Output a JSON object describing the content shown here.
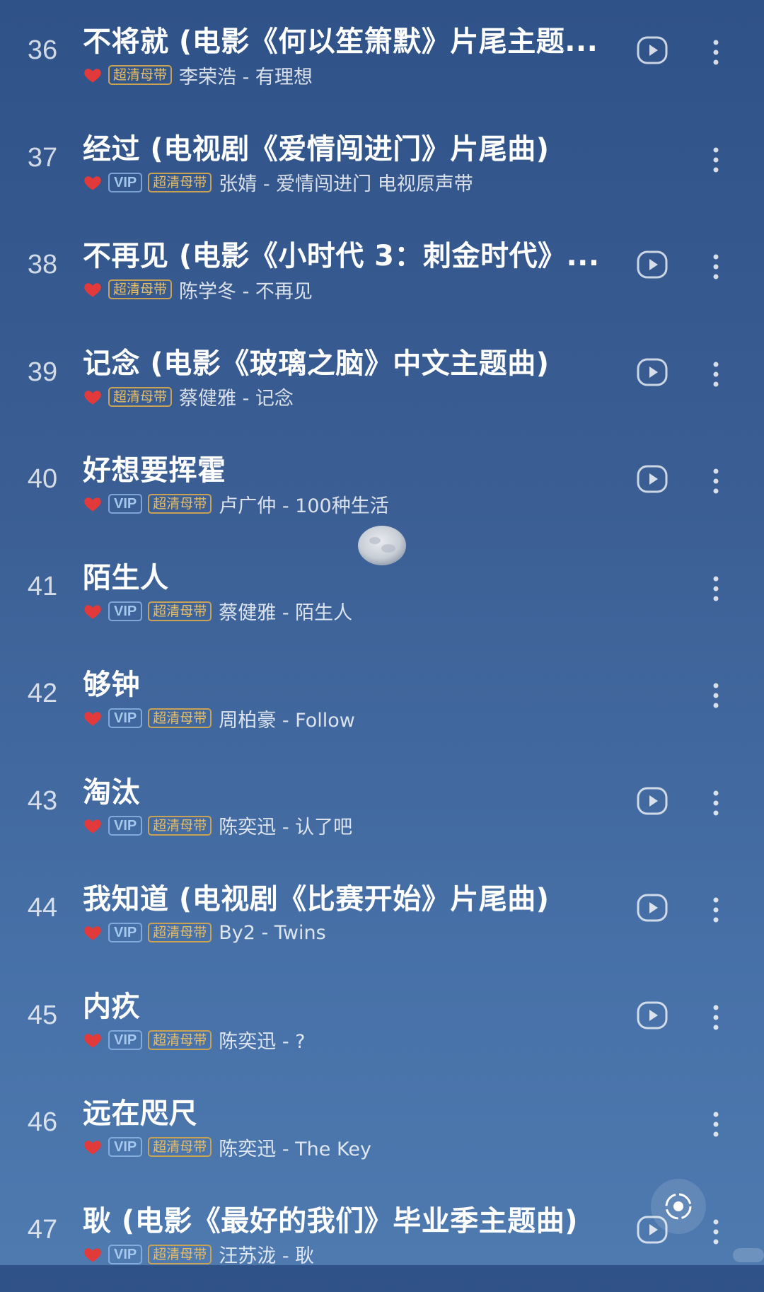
{
  "vip_label": "VIP",
  "hq_label": "超清母带",
  "colors": {
    "heart": "#e23a3a",
    "hq_gold": "#e6be6a",
    "vip_blue": "#aacdf0"
  },
  "songs": [
    {
      "num": "36",
      "title": "不将就 (电影《何以笙箫默》片尾主题...",
      "artist": "李荣浩 - 有理想",
      "vip": false,
      "play": true
    },
    {
      "num": "37",
      "title": "经过 (电视剧《爱情闯进门》片尾曲)",
      "artist": "张婧 - 爱情闯进门 电视原声带",
      "vip": true,
      "play": false
    },
    {
      "num": "38",
      "title": "不再见 (电影《小时代 3：刺金时代》...",
      "artist": "陈学冬 - 不再见",
      "vip": false,
      "play": true
    },
    {
      "num": "39",
      "title": "记念 (电影《玻璃之脑》中文主题曲)",
      "artist": "蔡健雅 - 记念",
      "vip": false,
      "play": true
    },
    {
      "num": "40",
      "title": "好想要挥霍",
      "artist": "卢广仲 - 100种生活",
      "vip": true,
      "play": true
    },
    {
      "num": "41",
      "title": "陌生人",
      "artist": "蔡健雅 - 陌生人",
      "vip": true,
      "play": false
    },
    {
      "num": "42",
      "title": "够钟",
      "artist": "周柏豪 - Follow",
      "vip": true,
      "play": false
    },
    {
      "num": "43",
      "title": "淘汰",
      "artist": "陈奕迅 - 认了吧",
      "vip": true,
      "play": true
    },
    {
      "num": "44",
      "title": "我知道 (电视剧《比赛开始》片尾曲)",
      "artist": "By2 - Twins",
      "vip": true,
      "play": true
    },
    {
      "num": "45",
      "title": "内疚",
      "artist": "陈奕迅 - ?",
      "vip": true,
      "play": true
    },
    {
      "num": "46",
      "title": "远在咫尺",
      "artist": "陈奕迅 - The Key",
      "vip": true,
      "play": false
    },
    {
      "num": "47",
      "title": "耿 (电影《最好的我们》毕业季主题曲)",
      "artist": "汪苏泷 - 耿",
      "vip": true,
      "play": true
    }
  ]
}
